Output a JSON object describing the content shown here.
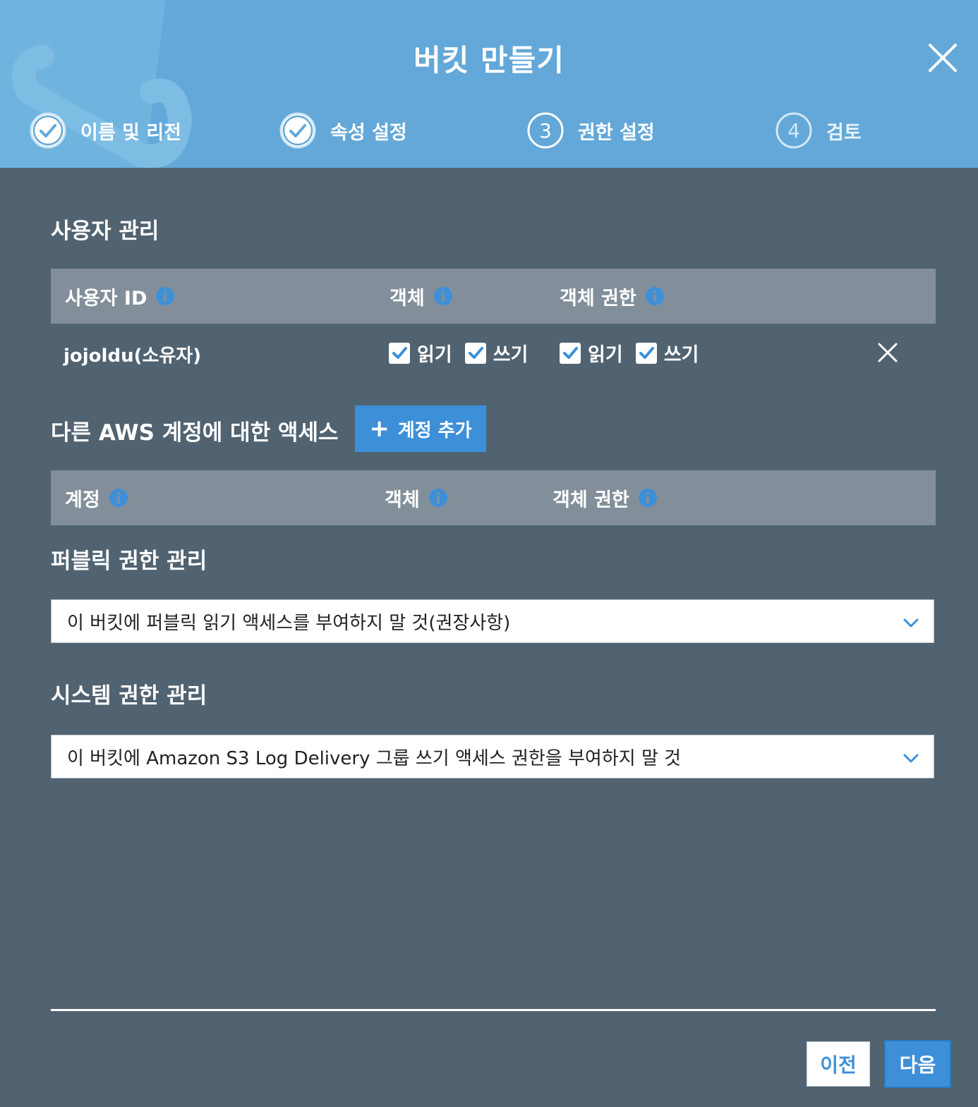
{
  "dialog": {
    "title": "버킷 만들기"
  },
  "steps": [
    {
      "label": "이름 및 리전",
      "state": "done"
    },
    {
      "label": "속성 설정",
      "state": "done"
    },
    {
      "label": "권한 설정",
      "state": "active",
      "number": "3"
    },
    {
      "label": "검토",
      "state": "pending",
      "number": "4"
    }
  ],
  "user_management": {
    "title": "사용자 관리",
    "columns": [
      "사용자 ID",
      "객체",
      "객체 권한"
    ],
    "rows": [
      {
        "user_id": "jojoldu(소유자)",
        "object": [
          {
            "label": "읽기",
            "checked": true
          },
          {
            "label": "쓰기",
            "checked": true
          }
        ],
        "object_permission": [
          {
            "label": "읽기",
            "checked": true
          },
          {
            "label": "쓰기",
            "checked": true
          }
        ]
      }
    ]
  },
  "other_accounts": {
    "title": "다른 AWS 계정에 대한 액세스",
    "add_button": "계정 추가",
    "columns": [
      "계정",
      "객체",
      "객체 권한"
    ]
  },
  "public_permissions": {
    "title": "퍼블릭 권한 관리",
    "selected": "이 버킷에 퍼블릭 읽기 액세스를 부여하지 말 것(권장사항)"
  },
  "system_permissions": {
    "title": "시스템 권한 관리",
    "selected": "이 버킷에 Amazon S3 Log Delivery 그룹 쓰기 액세스 권한을 부여하지 말 것"
  },
  "footer": {
    "prev_label": "이전",
    "next_label": "다음"
  },
  "colors": {
    "header": "#63a8d8",
    "body": "#516270",
    "table_header": "#828f9a",
    "accent": "#3d8fd8"
  }
}
